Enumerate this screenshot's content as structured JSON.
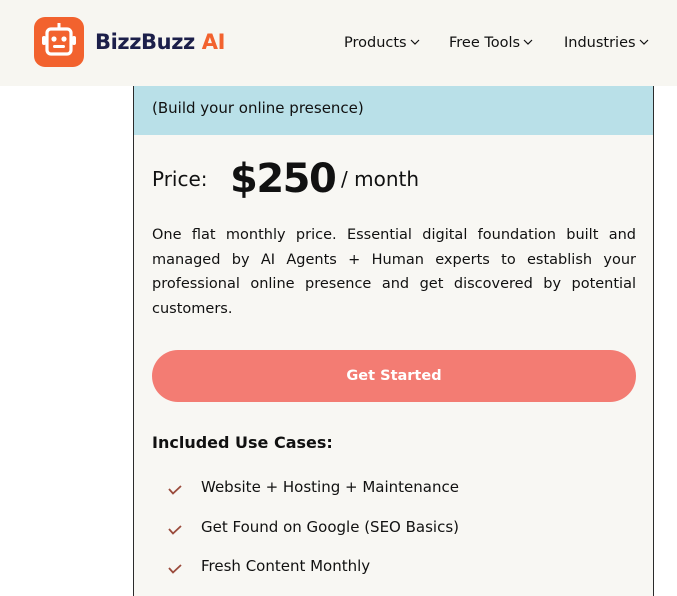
{
  "brand": {
    "name_part1": "BizzBuzz",
    "name_part2": " AI",
    "primary_color": "#f2622e",
    "dark_color": "#1c1f4a",
    "logo_icon": "robot-icon"
  },
  "nav": {
    "items": [
      {
        "label": "Products",
        "icon": "chevron-down-icon"
      },
      {
        "label": "Free Tools",
        "icon": "chevron-down-icon"
      },
      {
        "label": "Industries",
        "icon": "chevron-down-icon"
      }
    ]
  },
  "plan": {
    "subtitle": "(Build your online presence)",
    "price_label": "Price:",
    "price": "$250",
    "period": "/ month",
    "description": "One flat monthly price. Essential digital foundation built and managed by AI Agents + Human experts to establish your professional online presence and get discovered by potential customers.",
    "cta_label": "Get Started",
    "band_color": "#b9e0e8",
    "cta_color": "#f37c73",
    "use_cases_heading": "Included Use Cases:",
    "use_cases": [
      "Website + Hosting + Maintenance",
      "Get Found on Google (SEO Basics)",
      "Fresh Content Monthly"
    ],
    "check_icon": "check-icon"
  }
}
